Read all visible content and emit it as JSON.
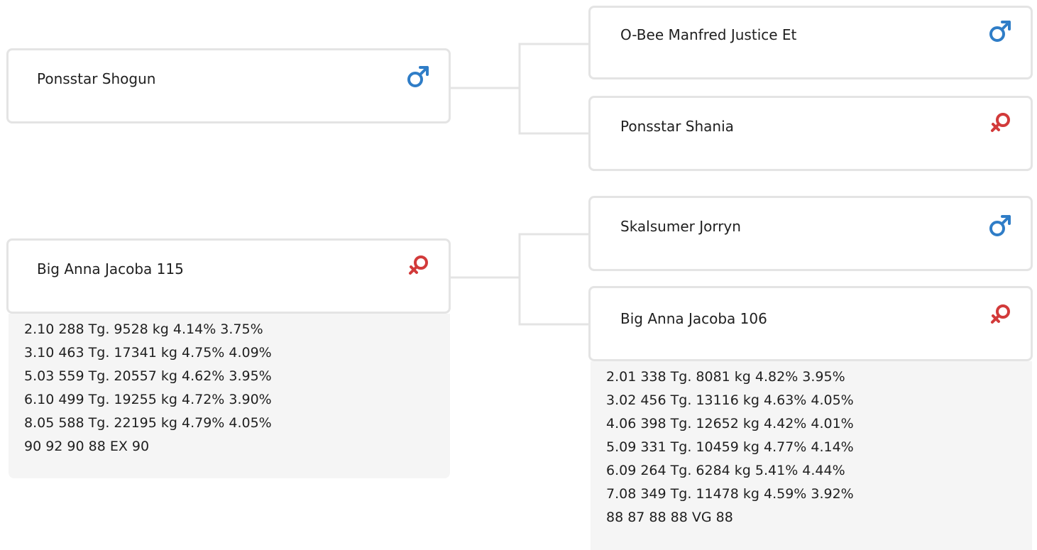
{
  "colors": {
    "male": "#2f7dc7",
    "female": "#d23a3a"
  },
  "sire": {
    "name": "Ponsstar Shogun",
    "sex": "male",
    "sex_icon": "male-symbol-icon",
    "sire": {
      "name": "O-Bee Manfred Justice Et",
      "sex": "male",
      "sex_icon": "male-symbol-icon"
    },
    "dam": {
      "name": "Ponsstar Shania",
      "sex": "female",
      "sex_icon": "female-symbol-icon"
    }
  },
  "dam": {
    "name": "Big Anna Jacoba 115",
    "sex": "female",
    "sex_icon": "female-symbol-icon",
    "stats": [
      "2.10 288 Tg. 9528 kg 4.14% 3.75%",
      "3.10 463 Tg. 17341 kg 4.75% 4.09%",
      "5.03 559 Tg. 20557 kg 4.62% 3.95%",
      "6.10 499 Tg. 19255 kg 4.72% 3.90%",
      "8.05 588 Tg. 22195 kg 4.79% 4.05%",
      "90 92 90 88 EX 90"
    ],
    "sire": {
      "name": "Skalsumer Jorryn",
      "sex": "male",
      "sex_icon": "male-symbol-icon"
    },
    "dam": {
      "name": "Big Anna Jacoba 106",
      "sex": "female",
      "sex_icon": "female-symbol-icon",
      "stats": [
        "2.01 338 Tg. 8081 kg 4.82% 3.95%",
        "3.02 456 Tg. 13116 kg 4.63% 4.05%",
        "4.06 398 Tg. 12652 kg 4.42% 4.01%",
        "5.09 331 Tg. 10459 kg 4.77% 4.14%",
        "6.09 264 Tg. 6284 kg 5.41% 4.44%",
        "7.08 349 Tg. 11478 kg 4.59% 3.92%",
        "88 87 88 88 VG 88"
      ]
    }
  }
}
